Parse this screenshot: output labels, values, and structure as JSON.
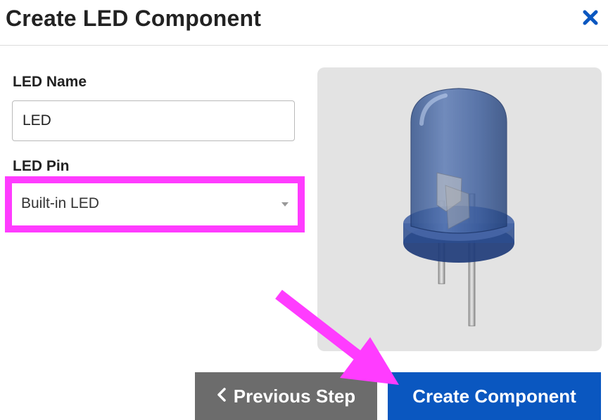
{
  "dialog": {
    "title": "Create LED Component",
    "close_icon": "close-x-icon"
  },
  "form": {
    "name_label": "LED Name",
    "name_value": "LED",
    "pin_label": "LED Pin",
    "pin_value": "Built-in LED"
  },
  "preview": {
    "image": "led-component-image"
  },
  "buttons": {
    "previous_label": "Previous Step",
    "previous_icon": "chevron-left-icon",
    "create_label": "Create Component"
  },
  "annotations": {
    "highlight_color": "#ff3cff",
    "arrow_color": "#ff3cff"
  },
  "colors": {
    "primary": "#0a57c0",
    "secondary": "#6c6c6c",
    "close_icon": "#0a57c0"
  }
}
